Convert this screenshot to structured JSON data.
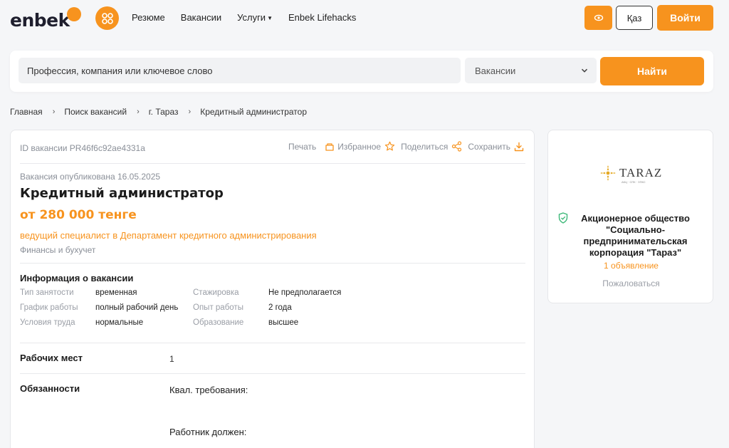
{
  "colors": {
    "accent": "#f7931e",
    "background": "#f5f6f8"
  },
  "header": {
    "logo_text": "enbek",
    "nav": [
      {
        "label": "Резюме"
      },
      {
        "label": "Вакансии"
      },
      {
        "label": "Услуги",
        "has_dropdown": true
      },
      {
        "label": "Enbek Lifehacks"
      }
    ],
    "lang_label": "Қаз",
    "login_label": "Войти",
    "icons": {
      "apps": "apps-grid-icon",
      "accessibility": "eye-icon"
    }
  },
  "search": {
    "placeholder": "Профессия, компания или ключевое слово",
    "category_selected": "Вакансии",
    "button_label": "Найти"
  },
  "breadcrumb": [
    "Главная",
    "Поиск вакансий",
    "г. Тараз",
    "Кредитный администратор"
  ],
  "vacancy": {
    "id_text": "ID вакансии PR46f6c92ae4331a",
    "actions": [
      {
        "label": "Печать",
        "icon": "print-icon"
      },
      {
        "label": "Избранное",
        "icon": "star-icon"
      },
      {
        "label": "Поделиться",
        "icon": "share-icon"
      },
      {
        "label": "Сохранить",
        "icon": "download-icon"
      }
    ],
    "published": "Вакансия опубликована 16.05.2025",
    "title": "Кредитный администратор",
    "salary": "от 280 000 тенге",
    "subtitle": "ведущий специалист в Департамент кредитного администрирования",
    "category": "Финансы и бухучет",
    "info_heading": "Информация о вакансии",
    "info_rows": [
      {
        "l1": "Тип занятости",
        "v1": "временная",
        "l2": "Стажировка",
        "v2": "Не предполагается"
      },
      {
        "l1": "График работы",
        "v1": "полный рабочий день",
        "l2": "Опыт работы",
        "v2": "2 года"
      },
      {
        "l1": "Условия труда",
        "v1": "нормальные",
        "l2": "Образование",
        "v2": "высшее"
      }
    ],
    "workplaces_label": "Рабочих мест",
    "workplaces_value": "1",
    "duties_label": "Обязанности",
    "duties_text1": "Квал. требования:",
    "duties_text2": "Работник должен:"
  },
  "company": {
    "logo_text": "TARAZ",
    "logo_sub": "АКЦ · СПК · ЗПКС",
    "name": "Акционерное общество \"Социально-предпринимательская корпорация \"Тараз\"",
    "ads": "1 объявление",
    "complain": "Пожаловаться"
  }
}
